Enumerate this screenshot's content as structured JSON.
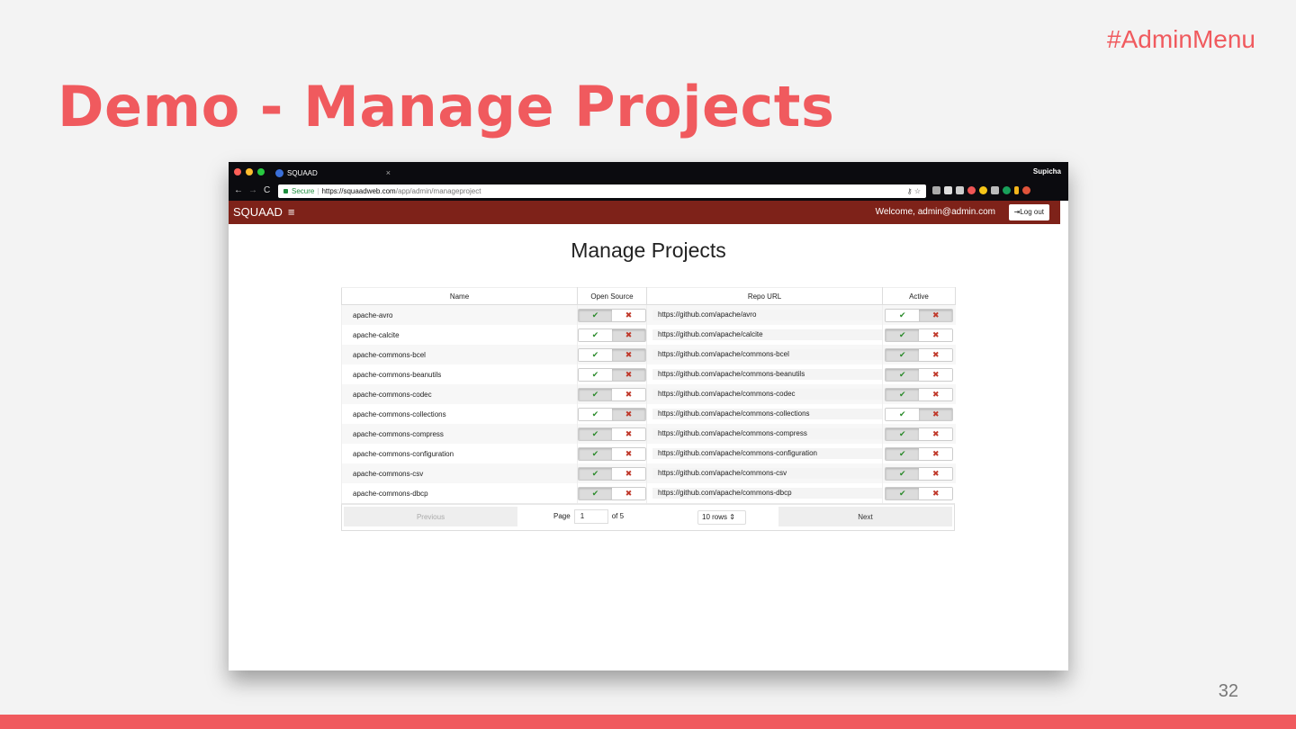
{
  "slide": {
    "tag": "#AdminMenu",
    "title": "Demo - Manage Projects",
    "page_number": "32",
    "accent_color": "#f05a5e"
  },
  "browser": {
    "tab_title": "SQUAAD",
    "tab_close": "×",
    "profile_name": "Supicha",
    "nav": {
      "back": "←",
      "forward": "→",
      "reload": "C"
    },
    "address": {
      "secure_label": "Secure",
      "url_host": "https://squaadweb.com",
      "url_path": "/app/admin/manageproject",
      "key_icon": "⚷",
      "star_icon": "☆"
    }
  },
  "app": {
    "brand": "SQUAAD",
    "menu_icon": "≡",
    "welcome": "Welcome, admin@admin.com",
    "logout_label": "Log out",
    "logout_icon": "⇥",
    "header_color": "#7e2219",
    "page_title": "Manage Projects",
    "columns": [
      "Name",
      "Open Source",
      "Repo URL",
      "Active"
    ],
    "check_glyph": "✔",
    "cross_glyph": "✖",
    "projects": [
      {
        "name": "apache-avro",
        "url": "https://github.com/apache/avro",
        "open_source": true,
        "active": false
      },
      {
        "name": "apache-calcite",
        "url": "https://github.com/apache/calcite",
        "open_source": false,
        "active": true
      },
      {
        "name": "apache-commons-bcel",
        "url": "https://github.com/apache/commons-bcel",
        "open_source": false,
        "active": true
      },
      {
        "name": "apache-commons-beanutils",
        "url": "https://github.com/apache/commons-beanutils",
        "open_source": false,
        "active": true
      },
      {
        "name": "apache-commons-codec",
        "url": "https://github.com/apache/commons-codec",
        "open_source": true,
        "active": true
      },
      {
        "name": "apache-commons-collections",
        "url": "https://github.com/apache/commons-collections",
        "open_source": false,
        "active": false
      },
      {
        "name": "apache-commons-compress",
        "url": "https://github.com/apache/commons-compress",
        "open_source": true,
        "active": true
      },
      {
        "name": "apache-commons-configuration",
        "url": "https://github.com/apache/commons-configuration",
        "open_source": true,
        "active": true
      },
      {
        "name": "apache-commons-csv",
        "url": "https://github.com/apache/commons-csv",
        "open_source": true,
        "active": true
      },
      {
        "name": "apache-commons-dbcp",
        "url": "https://github.com/apache/commons-dbcp",
        "open_source": true,
        "active": true
      }
    ],
    "pagination": {
      "previous_label": "Previous",
      "page_label": "Page",
      "current_page": "1",
      "of_label": "of 5",
      "rows_label": "10 rows",
      "rows_arrow": "⇕",
      "next_label": "Next"
    }
  }
}
